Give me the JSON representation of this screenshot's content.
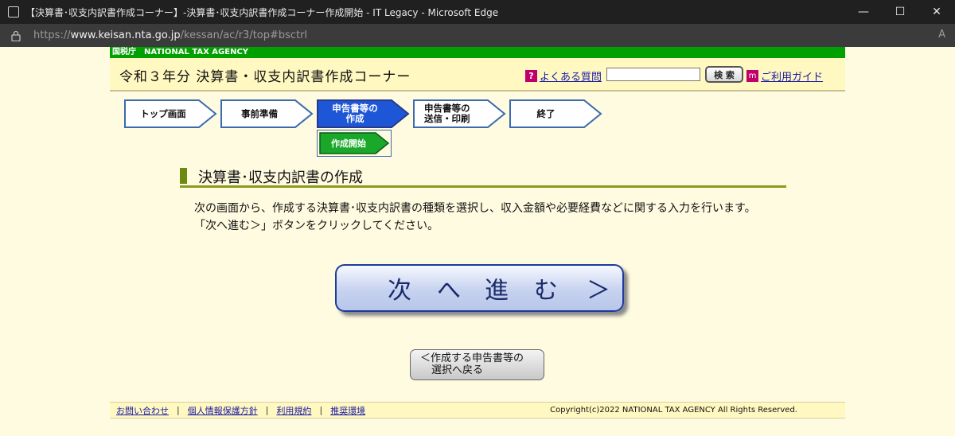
{
  "window": {
    "title": "【決算書･収支内訳書作成コーナー】-決算書･収支内訳書作成コーナー作成開始 - IT Legacy - Microsoft Edge",
    "controls": {
      "minimize": "—",
      "maximize": "☐",
      "close": "✕"
    }
  },
  "address_bar": {
    "url_prefix": "https://",
    "url_host": "www.keisan.nta.go.jp",
    "url_path": "/kessan/ac/r3/top#bsctrl",
    "read_aloud": "A"
  },
  "agency": {
    "label": "国税庁　NATIONAL TAX AGENCY"
  },
  "header": {
    "page_title": "令和３年分 決算書・収支内訳書作成コーナー",
    "faq_icon": "?",
    "faq_link": "よくある質問",
    "search_placeholder": "",
    "search_button": "検 索",
    "guide_icon": "m",
    "guide_link": "ご利用ガイド"
  },
  "steps": [
    {
      "label": "トップ画面",
      "state": "inactive"
    },
    {
      "label": "事前準備",
      "state": "inactive"
    },
    {
      "label": "申告書等の作成",
      "line1": "申告書等の",
      "line2": "作成",
      "state": "active"
    },
    {
      "label": "申告書等の送信・印刷",
      "line1": "申告書等の",
      "line2": "送信・印刷",
      "state": "inactive"
    },
    {
      "label": "終了",
      "state": "inactive"
    }
  ],
  "substep": {
    "label": "作成開始"
  },
  "section": {
    "title": "決算書･収支内訳書の作成",
    "desc_line1": "次の画面から、作成する決算書･収支内訳書の種類を選択し、収入金額や必要経費などに関する入力を行います。",
    "desc_line2": "「次へ進む＞」ボタンをクリックしてください。"
  },
  "buttons": {
    "next_chars": [
      "次",
      "へ",
      "進",
      "む",
      "＞"
    ],
    "back_line1": "＜作成する申告書等の",
    "back_line2": "選択へ戻る"
  },
  "footer": {
    "links": [
      "お問い合わせ",
      "個人情報保護方針",
      "利用規約",
      "推奨環境"
    ],
    "separator": "|",
    "copyright": "Copyright(c)2022 NATIONAL TAX AGENCY All Rights Reserved."
  },
  "colors": {
    "agency_bar": "#00a000",
    "active_step": "#1e56d8",
    "substep": "#1aa82a",
    "page_bg": "#fffbe0"
  }
}
